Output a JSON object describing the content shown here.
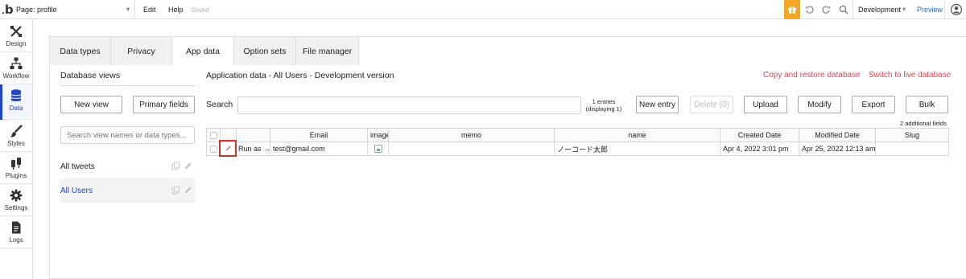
{
  "topbar": {
    "logo": "b",
    "page_selector": "Page: profile",
    "menu_edit": "Edit",
    "menu_help": "Help",
    "save_status": "Saved",
    "environment": "Development",
    "preview": "Preview",
    "icons": [
      "gift-icon",
      "undo-icon",
      "redo-icon",
      "search-icon",
      "account-icon"
    ],
    "accent": "#f5a623"
  },
  "sidebar": {
    "items": [
      {
        "label": "Design",
        "icon": "design-icon"
      },
      {
        "label": "Workflow",
        "icon": "workflow-icon"
      },
      {
        "label": "Data",
        "icon": "database-icon",
        "active": true
      },
      {
        "label": "Styles",
        "icon": "brush-icon"
      },
      {
        "label": "Plugins",
        "icon": "plug-icon"
      },
      {
        "label": "Settings",
        "icon": "gear-icon"
      },
      {
        "label": "Logs",
        "icon": "document-icon"
      }
    ],
    "active_color": "#2246c8"
  },
  "tabs": [
    {
      "label": "Data types"
    },
    {
      "label": "Privacy"
    },
    {
      "label": "App data",
      "active": true
    },
    {
      "label": "Option sets"
    },
    {
      "label": "File manager"
    }
  ],
  "views": {
    "heading": "Database views",
    "new_view": "New view",
    "primary_fields": "Primary fields",
    "search_placeholder": "Search view names or data types...",
    "items": [
      {
        "label": "All tweets"
      },
      {
        "label": "All Users",
        "selected": true
      }
    ]
  },
  "appdata": {
    "heading": "Application data - All Users - Development version",
    "copy_restore": "Copy and restore database",
    "switch_live": "Switch to live database",
    "search_label": "Search",
    "search_value": "",
    "entries_line1": "1 entries",
    "entries_line2": "(displaying 1)",
    "btn_new_entry": "New entry",
    "btn_delete": "Delete (0)",
    "btn_upload": "Upload",
    "btn_modify": "Modify",
    "btn_export": "Export",
    "btn_bulk": "Bulk",
    "additional_fields": "2 additional fields",
    "link_color": "#e0475a"
  },
  "table": {
    "columns": [
      "Email",
      "image",
      "memo",
      "name",
      "Created Date",
      "Modified Date",
      "Slug"
    ],
    "rows": [
      {
        "run_as": "Run as →",
        "email": "test@gmail.com",
        "memo": "",
        "name": "ノーコード太郎",
        "created": "Apr 4, 2022 3:01 pm",
        "modified": "Apr 25, 2022 12:13 am",
        "slug": ""
      }
    ]
  }
}
